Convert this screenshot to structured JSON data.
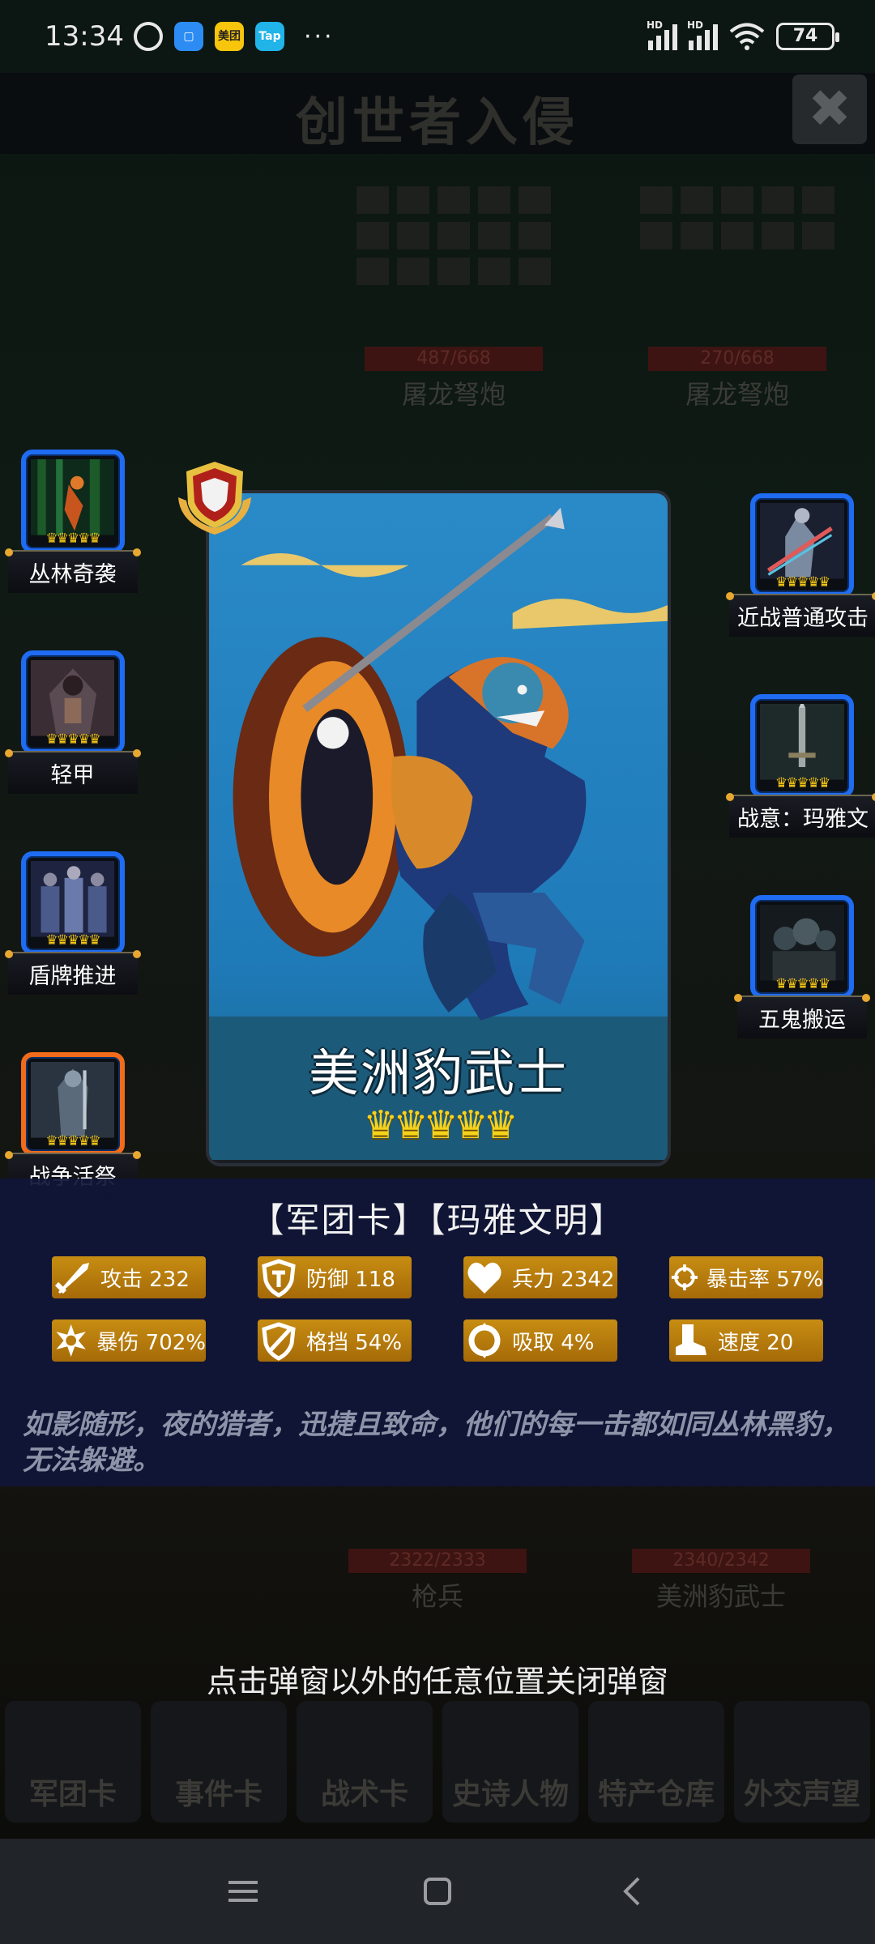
{
  "status_bar": {
    "time": "13:34",
    "app_icons": [
      {
        "name": "app-icon-chat",
        "label": ""
      },
      {
        "name": "app-icon-meituan",
        "label": "美团"
      },
      {
        "name": "app-icon-tap",
        "label": "Tap"
      }
    ],
    "more": "···",
    "signal_1": "HD",
    "signal_2": "HD",
    "battery": "74"
  },
  "background": {
    "title": "创世者入侵",
    "close": "✖",
    "units": [
      {
        "hp": "487/668",
        "name": "屠龙弩炮"
      },
      {
        "hp": "270/668",
        "name": "屠龙弩炮"
      },
      {
        "hp": "2322/2333",
        "name": "枪兵"
      },
      {
        "hp": "2340/2342",
        "name": "美洲豹武士"
      }
    ],
    "bottom_tabs": [
      "军团卡",
      "事件卡",
      "战术卡",
      "史诗人物",
      "特产仓库",
      "外交声望"
    ]
  },
  "modal": {
    "left_skills": [
      {
        "label": "丛林奇袭",
        "crowns": "♛♛♛♛♛"
      },
      {
        "label": "轻甲",
        "crowns": "♛♛♛♛♛"
      },
      {
        "label": "盾牌推进",
        "crowns": "♛♛♛♛♛"
      },
      {
        "label": "战争活祭",
        "crowns": "♛♛♛♛♛"
      }
    ],
    "right_skills": [
      {
        "label": "近战普通攻击",
        "crowns": "♛♛♛♛♛"
      },
      {
        "label": "战意：玛雅文",
        "crowns": "♛♛♛♛♛"
      },
      {
        "label": "五鬼搬运",
        "crowns": "♛♛♛♛♛"
      }
    ],
    "card": {
      "name": "美洲豹武士",
      "stars": "♛♛♛♛♛",
      "star_count": 5
    },
    "info": {
      "header": "【军团卡】【玛雅文明】",
      "stats": [
        {
          "icon": "sword-icon",
          "text": "攻击 232"
        },
        {
          "icon": "shield-icon",
          "text": "防御 118"
        },
        {
          "icon": "heart-icon",
          "text": "兵力 2342"
        },
        {
          "icon": "crosshair-icon",
          "text": "暴击率 57%"
        },
        {
          "icon": "burst-icon",
          "text": "暴伤 702%"
        },
        {
          "icon": "parry-icon",
          "text": "格挡 54%"
        },
        {
          "icon": "absorb-icon",
          "text": "吸取 4%"
        },
        {
          "icon": "boot-icon",
          "text": "速度 20"
        }
      ],
      "description": "如影随形，夜的猎者，迅捷且致命，他们的每一击都如同丛林黑豹，无法躲避。"
    },
    "close_hint": "点击弹窗以外的任意位置关闭弹窗"
  },
  "colors": {
    "skill_border": "#1f6cf2",
    "skill_border_special": "#f06b1a",
    "stat_bg": "#b87b0d",
    "info_bg": "#10163a"
  }
}
